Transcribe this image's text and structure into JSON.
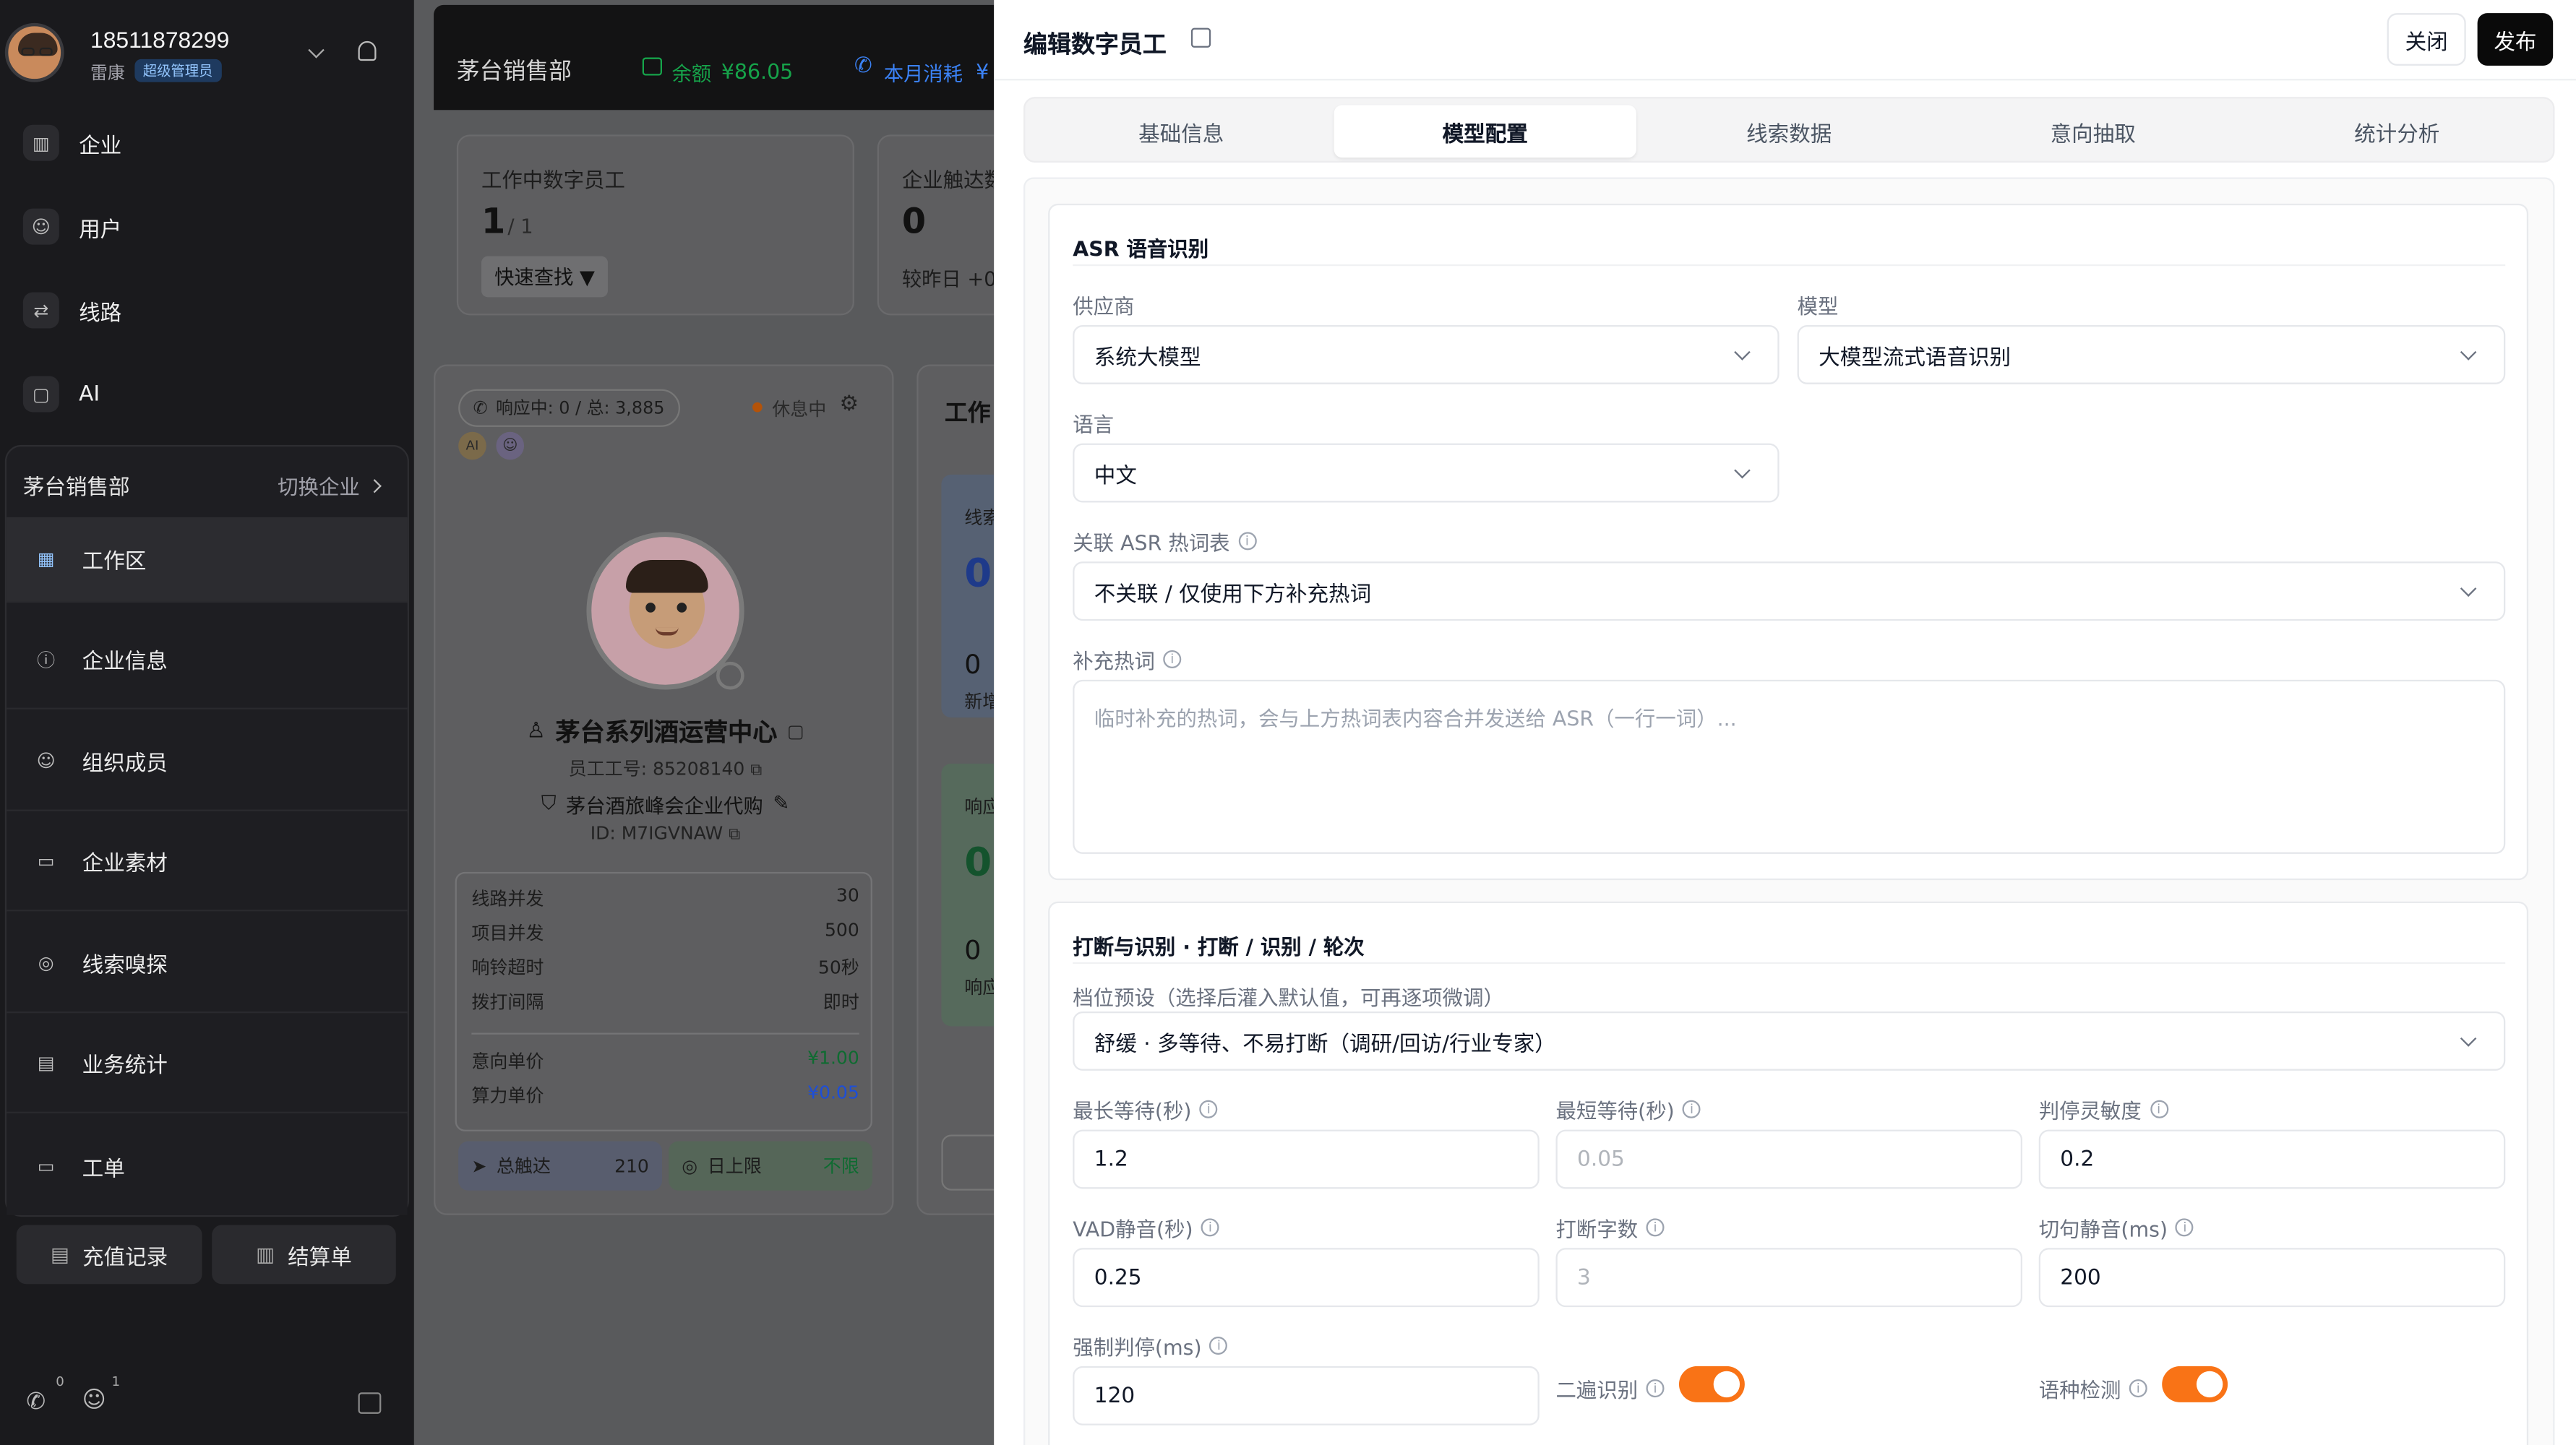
{
  "sidebar": {
    "user_phone": "18511878299",
    "user_name": "雷康",
    "user_role": "超级管理员",
    "nav": [
      {
        "label": "企业",
        "icon": "building-icon"
      },
      {
        "label": "用户",
        "icon": "users-icon"
      },
      {
        "label": "线路",
        "icon": "route-icon"
      },
      {
        "label": "AI",
        "icon": "ai-chat-icon"
      }
    ],
    "company_name": "茅台销售部",
    "switch_company": "切换企业",
    "sub_nav": [
      {
        "label": "工作区",
        "icon": "grid-icon"
      },
      {
        "label": "企业信息",
        "icon": "info-icon"
      },
      {
        "label": "组织成员",
        "icon": "members-icon"
      },
      {
        "label": "企业素材",
        "icon": "folder-icon"
      },
      {
        "label": "线索嗅探",
        "icon": "radar-icon"
      },
      {
        "label": "业务统计",
        "icon": "bar-chart-icon"
      },
      {
        "label": "工单",
        "icon": "ticket-icon"
      }
    ],
    "recharge_button": "充值记录",
    "settlement_button": "结算单",
    "phone_badge": "0",
    "people_badge": "1"
  },
  "background": {
    "header_title": "茅台销售部",
    "balance_label": "余额",
    "balance_value": "¥86.05",
    "month_label": "本月消耗",
    "month_value": "¥",
    "stat1_title": "工作中数字员工",
    "stat1_value": "1",
    "stat1_total": "/ 1",
    "quick_find": "快速查找 ▼",
    "stat2_title": "企业触达数",
    "stat2_value": "0",
    "stat2_sub": "较昨日 +0",
    "response_chip": "响应中: 0 / 总: 3,885",
    "rest_status": "休息中",
    "ai_badge": "AI",
    "agent_name": "茅台系列酒运营中心",
    "employee_id": "员工工号: 85208140",
    "company_line": "茅台酒旅峰会企业代购",
    "id_line": "ID: M7IGVNAW",
    "metrics": [
      {
        "label": "线路并发",
        "value": "30"
      },
      {
        "label": "项目并发",
        "value": "500"
      },
      {
        "label": "响铃超时",
        "value": "50秒"
      },
      {
        "label": "拨打间隔",
        "value": "即时"
      }
    ],
    "prices": [
      {
        "label": "意向单价",
        "value": "¥1.00"
      },
      {
        "label": "算力单价",
        "value": "¥0.05"
      }
    ],
    "reach_label": "总触达",
    "reach_value": "210",
    "daily_label": "日上限",
    "daily_value": "不限",
    "work_title": "工作",
    "mini1_label": "线索",
    "mini1_value": "0",
    "mini1_sub_value": "0",
    "mini1_sub_label": "新增",
    "mini2_label": "响应",
    "mini2_value": "0",
    "mini2_sub_value": "0",
    "mini2_sub_label": "响应"
  },
  "panel": {
    "title": "编辑数字员工",
    "close_button": "关闭",
    "publish_button": "发布",
    "tabs": [
      "基础信息",
      "模型配置",
      "线索数据",
      "意向抽取",
      "统计分析"
    ],
    "active_tab": 1,
    "asr": {
      "section_title": "ASR 语音识别",
      "vendor_label": "供应商",
      "vendor_value": "系统大模型",
      "model_label": "模型",
      "model_value": "大模型流式语音识别",
      "lang_label": "语言",
      "lang_value": "中文",
      "hotword_label": "关联 ASR 热词表",
      "hotword_value": "不关联 / 仅使用下方补充热词",
      "extra_label": "补充热词",
      "extra_placeholder": "临时补充的热词，会与上方热词表内容合并发送给 ASR（一行一词）..."
    },
    "interrupt": {
      "section_title": "打断与识别 · 打断 / 识别 / 轮次",
      "preset_label": "档位预设（选择后灌入默认值，可再逐项微调）",
      "preset_value": "舒缓 · 多等待、不易打断（调研/回访/行业专家）",
      "fields": [
        {
          "label": "最长等待(秒)",
          "value": "1.2",
          "placeholder": false
        },
        {
          "label": "最短等待(秒)",
          "value": "0.05",
          "placeholder": true
        },
        {
          "label": "判停灵敏度",
          "value": "0.2",
          "placeholder": false
        },
        {
          "label": "VAD静音(秒)",
          "value": "0.25",
          "placeholder": false
        },
        {
          "label": "打断字数",
          "value": "3",
          "placeholder": true
        },
        {
          "label": "切句静音(ms)",
          "value": "200",
          "placeholder": false
        },
        {
          "label": "强制判停(ms)",
          "value": "120",
          "placeholder": false
        }
      ],
      "second_pass_label": "二遍识别",
      "lang_detect_label": "语种检测",
      "second_pass_on": true,
      "lang_detect_on": true
    }
  },
  "colors": {
    "accent": "#f97316",
    "sidebar_bg": "#1a1a1d",
    "money_green": "#22c55e"
  }
}
